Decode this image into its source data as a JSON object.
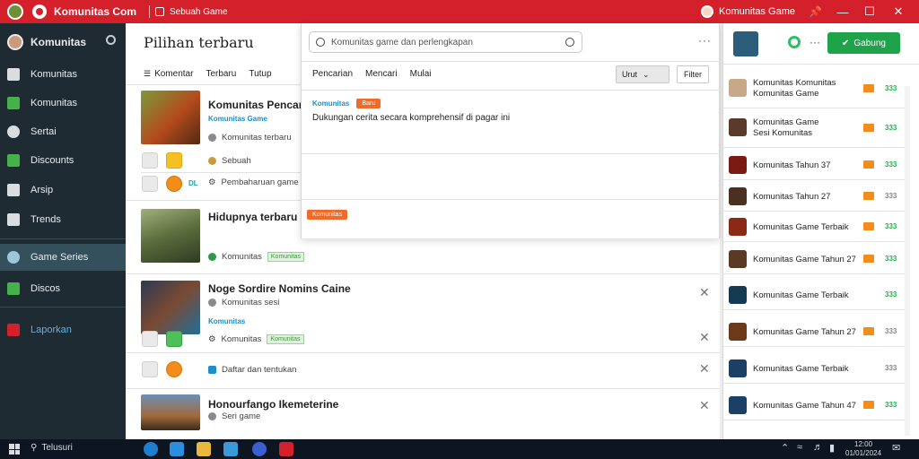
{
  "titlebar": {
    "app_title": "Komunitas Com",
    "tab_label": "Sebuah Game",
    "username": "Komunitas Game",
    "pin_icon": "pin-icon",
    "controls": [
      "—",
      "☐",
      "✕"
    ],
    "accent": "#d3202a"
  },
  "sidebar": {
    "header": "Komunitas",
    "items": [
      {
        "label": "Komunitas",
        "icon": "home-icon"
      },
      {
        "label": "Komunitas",
        "icon": "grid-icon"
      },
      {
        "label": "Sertai",
        "icon": "refresh-icon"
      },
      {
        "label": "Discounts",
        "icon": "tag-icon"
      },
      {
        "label": "Arsip",
        "icon": "archive-icon"
      },
      {
        "label": "Trends",
        "icon": "chart-icon"
      },
      {
        "label": "Game Series",
        "icon": "globe-icon",
        "active": true
      },
      {
        "label": "Discos",
        "icon": "check-icon"
      },
      {
        "label": "Laporkan",
        "icon": "flag-icon"
      }
    ]
  },
  "main": {
    "title": "Pilihan terbaru",
    "filters": [
      "Komentar",
      "Terbaru",
      "Tutup"
    ],
    "games": [
      {
        "title": "Komunitas Pencari",
        "tag": "Komunitas Game",
        "meta": "Komunitas terbaru",
        "meta2": "Sebuah",
        "meta3": "Pembaharuan game",
        "tag2": "DL"
      },
      {
        "title": "Hidupnya terbaru Sorc",
        "meta": "Komunitas",
        "badge": "Komunitas"
      },
      {
        "title": "Noge Sordire Nomins Caine",
        "meta": "Komunitas sesi",
        "tag": "Komunitas",
        "meta2": "Komunitas",
        "badge": "Komunitas",
        "meta3": "Daftar dan tentukan"
      },
      {
        "title": "Honourfango Ikemeterine",
        "meta": "Seri game"
      }
    ]
  },
  "dropdown": {
    "search_placeholder": "Komunitas game dan perlengkapan",
    "filters": [
      "Pencarian",
      "Mencari",
      "Mulai"
    ],
    "select_label": "Urut",
    "button_label": "Filter",
    "tab_active": "Komunitas",
    "tab_pill": "Baru",
    "body_text": "Dukungan cerita secara komprehensif di pagar ini",
    "footer_pill": "Komunitas"
  },
  "rightpanel": {
    "button_label": "Gabung",
    "rows": [
      {
        "name": "Komunitas Komunitas",
        "name2": "Komunitas Game",
        "num": "333"
      },
      {
        "name": "Komunitas Game",
        "name2": "Sesi Komunitas",
        "num": "333"
      },
      {
        "name": "Komunitas Tahun 37",
        "num": "333"
      },
      {
        "name": "Komunitas Tahun 27",
        "num": "333"
      },
      {
        "name": "Komunitas Game Terbaik",
        "num": "333"
      },
      {
        "name": "Komunitas Game Tahun 27",
        "num": "333"
      },
      {
        "name": "Komunitas Game Terbaik",
        "num": "333"
      },
      {
        "name": "Komunitas Game Tahun 27",
        "num": "333"
      },
      {
        "name": "Komunitas Game Terbaik",
        "num": "333"
      },
      {
        "name": "Komunitas Game Tahun 47",
        "num": "333"
      }
    ]
  },
  "taskbar": {
    "search_label": "Telusuri",
    "time": "12:00",
    "date": "01/01/2024"
  }
}
